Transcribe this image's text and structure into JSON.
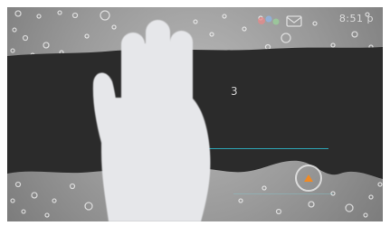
{
  "status_bar": {
    "time": "8:51 p",
    "icons": [
      "google-dots-icon",
      "mail-icon"
    ]
  },
  "screen": {
    "counter": "3"
  },
  "colors": {
    "accent": "#2fb6c8",
    "band": "#2b2b2b",
    "button_glyph": "#f08a24",
    "hand": "#e6e7ea"
  }
}
